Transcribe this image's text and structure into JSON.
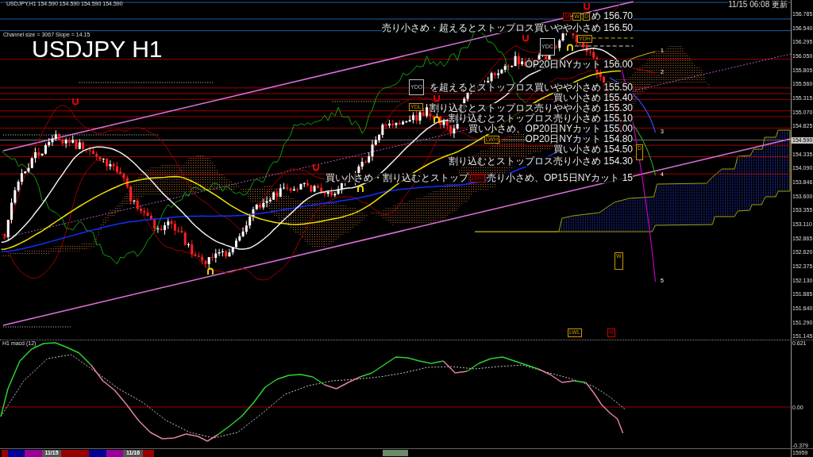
{
  "header": {
    "quote": "USDJPY,H1 154.590 154.590 154.590 154.590",
    "channel_info": "Channel size = 3067 Slope = 14.15",
    "title": "USDJPY H1",
    "updated": "11/15 06:08 更新"
  },
  "price_axis": [
    {
      "text": "156.785",
      "kind": "tick"
    },
    {
      "text": "156.540",
      "kind": "tick"
    },
    {
      "text": "156.295",
      "kind": "tick"
    },
    {
      "text": "156.050",
      "kind": "tick"
    },
    {
      "text": "155.805",
      "kind": "tick"
    },
    {
      "text": "155.560",
      "kind": "tick"
    },
    {
      "text": "155.315",
      "kind": "tick"
    },
    {
      "text": "155.070",
      "kind": "tick"
    },
    {
      "text": "154.825",
      "kind": "tick"
    },
    {
      "text": "154.590",
      "kind": "current"
    },
    {
      "text": "154.335",
      "kind": "tick"
    },
    {
      "text": "154.090",
      "kind": "tick"
    },
    {
      "text": "153.846",
      "kind": "tick"
    },
    {
      "text": "153.600",
      "kind": "tick"
    },
    {
      "text": "153.355",
      "kind": "tick"
    },
    {
      "text": "153.110",
      "kind": "tick"
    },
    {
      "text": "152.865",
      "kind": "tick"
    },
    {
      "text": "152.620",
      "kind": "tick"
    },
    {
      "text": "152.375",
      "kind": "tick"
    },
    {
      "text": "152.130",
      "kind": "tick"
    },
    {
      "text": "151.885",
      "kind": "tick"
    },
    {
      "text": "151.640",
      "kind": "tick"
    },
    {
      "text": "151.290",
      "kind": "tick"
    },
    {
      "text": "151.145",
      "kind": "tick"
    }
  ],
  "annotations": [
    {
      "parts": [
        {
          "kind": "tag",
          "label": "M",
          "color": "#cc0000"
        },
        {
          "kind": "tag",
          "label": "W",
          "color": "#c89a00"
        },
        {
          "kind": "tag",
          "label": "D",
          "color": "#c89a00"
        },
        {
          "kind": "text",
          "text": "め 156.70"
        }
      ]
    },
    {
      "parts": [
        {
          "kind": "text",
          "text": "売り小さめ・超えるとストップロス買いやや小さめ 156.50"
        }
      ]
    },
    {
      "parts": [
        {
          "kind": "text",
          "text": "OP20日NYカット 156.00"
        }
      ]
    },
    {
      "parts": [
        {
          "kind": "text",
          "text": "を超えるとストップロス買いやや小さめ 155.50"
        }
      ]
    },
    {
      "parts": [
        {
          "kind": "text",
          "text": "買い小さめ 155.40"
        }
      ]
    },
    {
      "parts": [
        {
          "kind": "text",
          "text": "割り込むとストップロス売りやや小さめ 155.30"
        }
      ]
    },
    {
      "parts": [
        {
          "kind": "text",
          "text": "割り込むとストップロス売り小さめ 155.10"
        }
      ]
    },
    {
      "parts": [
        {
          "kind": "text",
          "text": "買い小さめ、OP20日NYカット 155.00"
        }
      ]
    },
    {
      "parts": [
        {
          "kind": "text",
          "text": "OP20日NYカット 154.80"
        }
      ]
    },
    {
      "parts": [
        {
          "kind": "text",
          "text": "買い小さめ 154.50"
        }
      ]
    },
    {
      "parts": [
        {
          "kind": "text",
          "text": "割り込むとストップロス売り小さめ 154.30"
        }
      ]
    },
    {
      "parts": [
        {
          "kind": "text",
          "text": "買い小さめ・割り込むとストップ"
        },
        {
          "kind": "tag",
          "label": "LMH",
          "color": "#cc0000"
        },
        {
          "kind": "text",
          "text": "売り小さめ、OP15日NYカット 15"
        }
      ]
    }
  ],
  "chart_tags": [
    {
      "label": "YDC",
      "color": "#c0c0c0"
    },
    {
      "label": "YDH",
      "color": "#c89a00"
    },
    {
      "label": "YDO",
      "color": "#c0c0c0"
    },
    {
      "label": "YDL",
      "color": "#c89a00"
    },
    {
      "label": "LWH",
      "color": "#c89a00"
    },
    {
      "label": "D",
      "color": "#c89a00"
    },
    {
      "label": "W",
      "color": "#c89a00"
    },
    {
      "label": "LWL",
      "color": "#c89a00"
    },
    {
      "label": "M",
      "color": "#cc0000"
    }
  ],
  "wave_labels": [
    "1",
    "2",
    "3",
    "4",
    "5"
  ],
  "macd": {
    "title": "H1 macd (12)",
    "axis_labels": [
      "0.621",
      "0.00",
      "-0.379"
    ]
  },
  "date_bar": {
    "segments": [
      {
        "color": "#990000"
      },
      {
        "color": "#000099"
      },
      {
        "color": "#990099"
      },
      {
        "color": "#555555",
        "label": "11/15"
      },
      {
        "color": "#990000"
      },
      {
        "color": "#000099"
      },
      {
        "color": "#990099"
      },
      {
        "color": "#555555",
        "label": "11/16"
      },
      {
        "color": "#990000"
      }
    ]
  },
  "axis_footer": "15959"
}
